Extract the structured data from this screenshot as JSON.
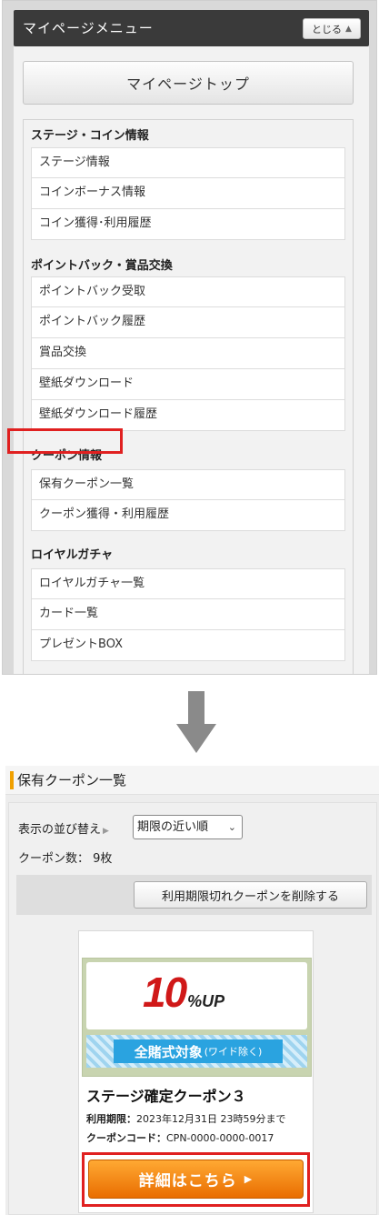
{
  "menu": {
    "title": "マイページメニュー",
    "close_label": "とじる",
    "close_icon": "▲",
    "top_button": "マイページトップ",
    "sections": [
      {
        "title": "ステージ・コイン情報",
        "items": [
          "ステージ情報",
          "コインボーナス情報",
          "コイン獲得･利用履歴"
        ]
      },
      {
        "title": "ポイントバック・賞品交換",
        "items": [
          "ポイントバック受取",
          "ポイントバック履歴",
          "賞品交換",
          "壁紙ダウンロード",
          "壁紙ダウンロード履歴"
        ]
      },
      {
        "title": "クーポン情報",
        "items": [
          "保有クーポン一覧",
          "クーポン獲得・利用履歴"
        ]
      },
      {
        "title": "ロイヤルガチャ",
        "items": [
          "ロイヤルガチャ一覧",
          "カード一覧",
          "プレゼントBOX"
        ]
      }
    ],
    "highlighted_item": "保有クーポン一覧"
  },
  "coupon_page": {
    "title": "保有クーポン一覧",
    "accent_color": "#f0a000",
    "sort_label": "表示の並び替え",
    "sort_icon": "▶",
    "sort_value": "期限の近い順",
    "count_text": "クーポン数： 9枚",
    "delete_button": "利用期限切れクーポンを削除する",
    "coupon": {
      "percent": "10",
      "unit": "%UP",
      "target": "全賭式対象",
      "target_sub": "(ワイド除く)",
      "name": "ステージ確定クーポン３",
      "expiry_label": "利用期限：",
      "expiry_value": "2023年12月31日 23時59分まで",
      "code_label": "クーポンコード：",
      "code_value": "CPN-0000-0000-0017",
      "detail_button": "詳細はこちら",
      "detail_icon": "▶"
    }
  },
  "colors": {
    "highlight": "#e02020",
    "detail_button": "#f08a10",
    "header_bg": "#3a3a3a"
  }
}
